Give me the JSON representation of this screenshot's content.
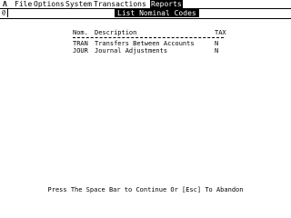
{
  "menubar": {
    "logo": "Λ",
    "items": [
      {
        "label": "File"
      },
      {
        "label": "Options"
      },
      {
        "label": "System"
      },
      {
        "label": "Transactions"
      },
      {
        "label": "Reports"
      }
    ]
  },
  "window": {
    "close_glyph": "@",
    "title": "List Nominal Codes"
  },
  "table": {
    "headers": {
      "code": "Nom.",
      "description": "Description",
      "tax": "TAX"
    },
    "rows": [
      {
        "code": "TRAN",
        "description": "Transfers Between Accounts",
        "tax": "N"
      },
      {
        "code": "JOUR",
        "description": "Journal Adjustments",
        "tax": "N"
      }
    ]
  },
  "footer": {
    "prompt": "Press The Space Bar to Continue Or [Esc] To Abandon"
  },
  "colors": {
    "foreground": "#000000",
    "background": "#ffffff"
  }
}
